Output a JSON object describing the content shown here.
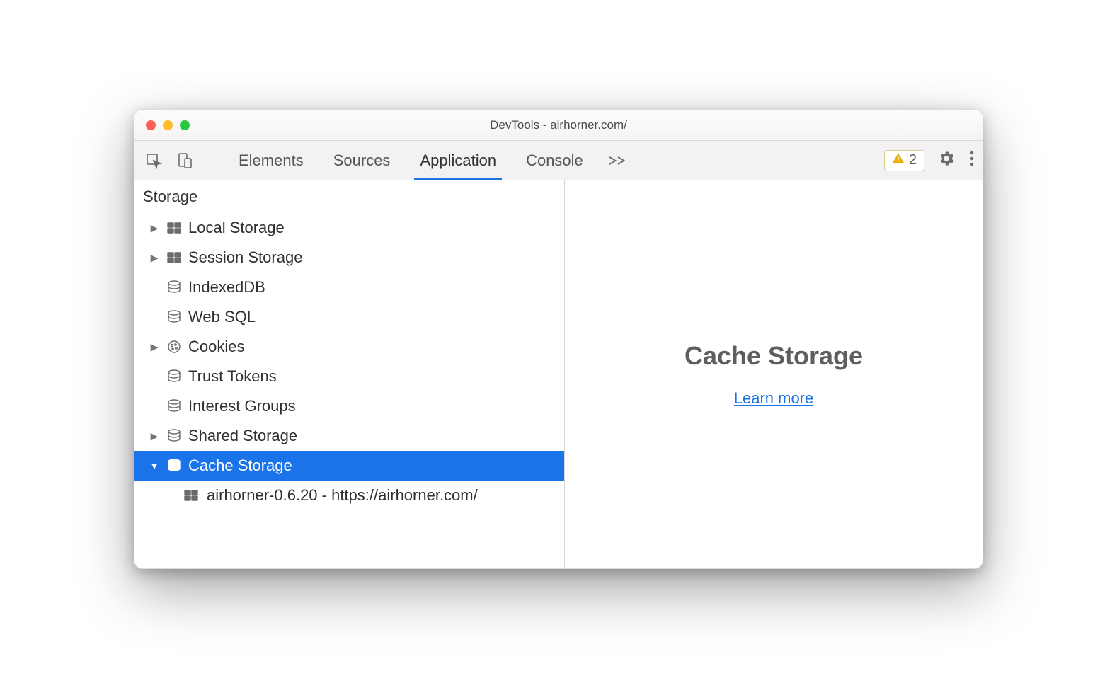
{
  "window": {
    "title": "DevTools - airhorner.com/"
  },
  "toolbar": {
    "tabs": [
      "Elements",
      "Sources",
      "Application",
      "Console"
    ],
    "active_tab_index": 2,
    "warning_count": "2"
  },
  "sidebar": {
    "section_title": "Storage",
    "items": [
      {
        "label": "Local Storage",
        "icon": "grid",
        "arrow": "right"
      },
      {
        "label": "Session Storage",
        "icon": "grid",
        "arrow": "right"
      },
      {
        "label": "IndexedDB",
        "icon": "database",
        "arrow": ""
      },
      {
        "label": "Web SQL",
        "icon": "database",
        "arrow": ""
      },
      {
        "label": "Cookies",
        "icon": "cookie",
        "arrow": "right"
      },
      {
        "label": "Trust Tokens",
        "icon": "database",
        "arrow": ""
      },
      {
        "label": "Interest Groups",
        "icon": "database",
        "arrow": ""
      },
      {
        "label": "Shared Storage",
        "icon": "database",
        "arrow": "right"
      },
      {
        "label": "Cache Storage",
        "icon": "database",
        "arrow": "down",
        "selected": true
      },
      {
        "label": "airhorner-0.6.20 - https://airhorner.com/",
        "icon": "grid",
        "arrow": "",
        "child": true
      }
    ]
  },
  "main": {
    "heading": "Cache Storage",
    "link_label": "Learn more"
  }
}
